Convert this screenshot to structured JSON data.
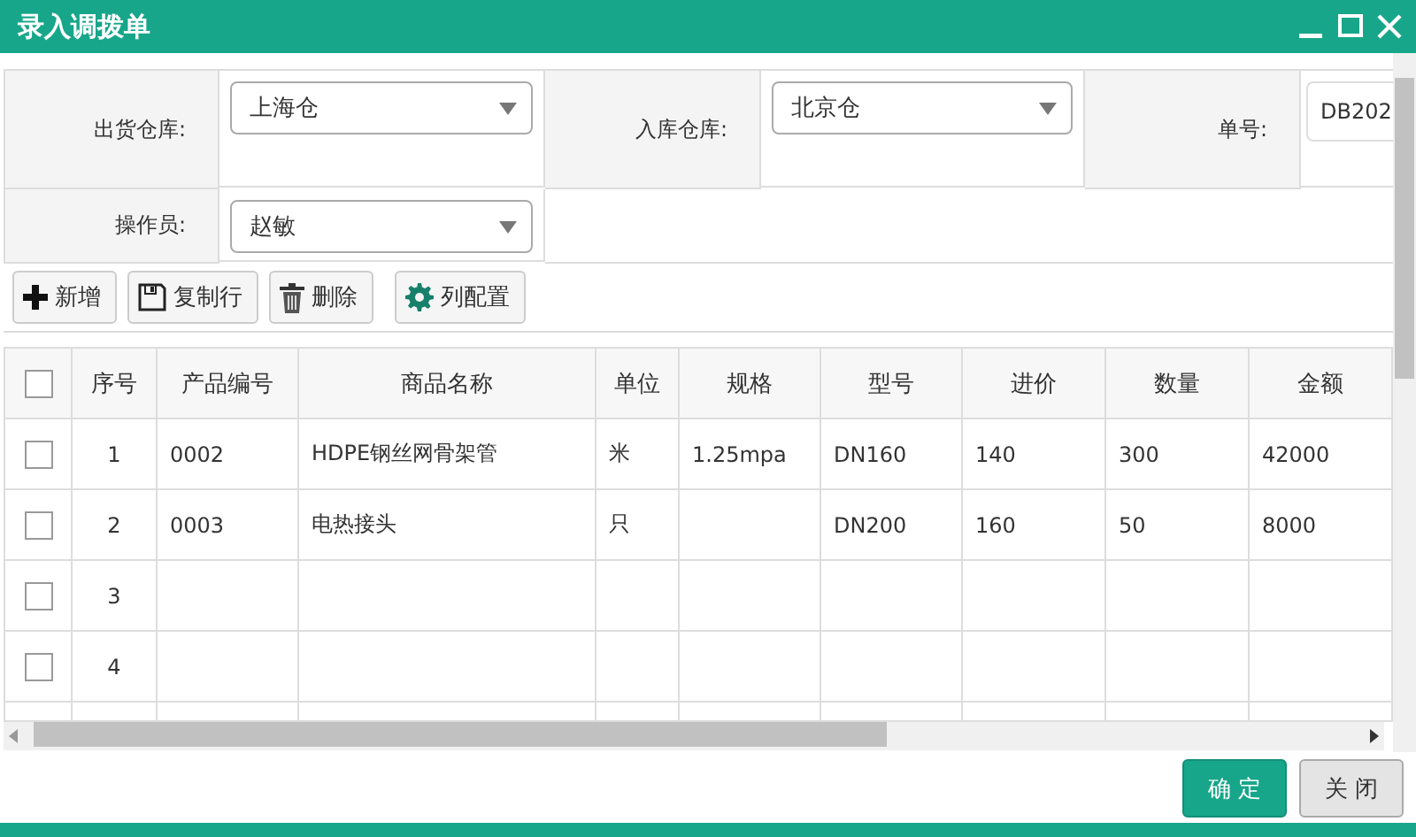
{
  "window": {
    "title": "录入调拨单"
  },
  "form": [
    {
      "label": "出货仓库:",
      "kind": "select",
      "value": "上海仓"
    },
    {
      "label": "入库仓库:",
      "kind": "select",
      "value": "北京仓"
    },
    {
      "label": "单号:",
      "kind": "input",
      "value": "DB202"
    },
    {
      "label": "操作员:",
      "kind": "select",
      "value": "赵敏"
    }
  ],
  "toolbar": [
    {
      "label": "新增",
      "kind": "add"
    },
    {
      "label": "复制行",
      "kind": "copy"
    },
    {
      "label": "删除",
      "kind": "delete"
    },
    {
      "label": "列配置",
      "kind": "config"
    }
  ],
  "table": {
    "header_checked": false,
    "columns": [
      "序号",
      "产品编号",
      "商品名称",
      "单位",
      "规格",
      "型号",
      "进价",
      "数量",
      "金额"
    ],
    "rows": [
      {
        "checked": false,
        "cells": [
          "1",
          "0002",
          "HDPE钢丝网骨架管",
          "米",
          "1.25mpa",
          "DN160",
          "140",
          "300",
          "42000"
        ]
      },
      {
        "checked": false,
        "cells": [
          "2",
          "0003",
          "电热接头",
          "只",
          "",
          "DN200",
          "160",
          "50",
          "8000"
        ]
      },
      {
        "checked": false,
        "cells": [
          "3",
          "",
          "",
          "",
          "",
          "",
          "",
          "",
          ""
        ]
      },
      {
        "checked": false,
        "cells": [
          "4",
          "",
          "",
          "",
          "",
          "",
          "",
          "",
          ""
        ]
      }
    ]
  },
  "buttons": [
    {
      "label": "确 定",
      "kind": "primary"
    },
    {
      "label": "关 闭",
      "kind": "default"
    }
  ]
}
